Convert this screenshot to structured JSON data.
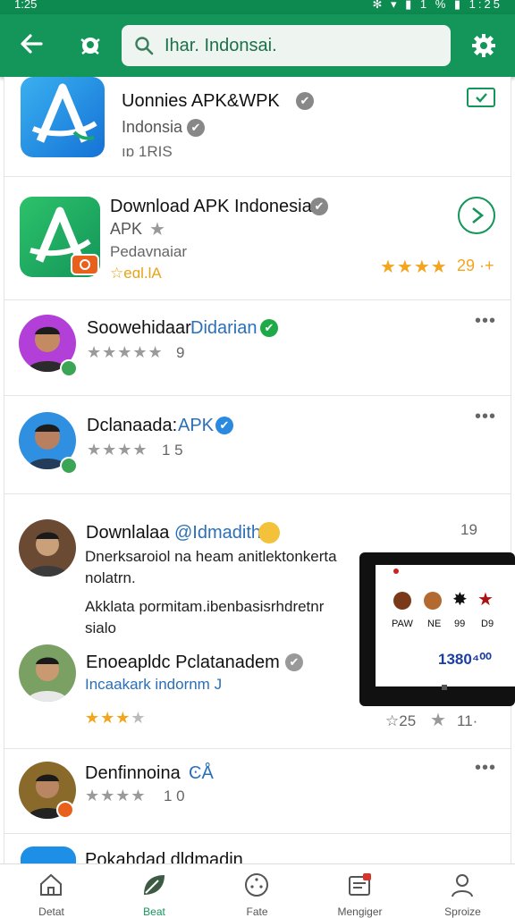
{
  "status_bar": {
    "time": "1:25",
    "right": "✻ ▾ ▮ 1 % ▮ 1:25"
  },
  "header": {
    "back_icon": "arrow-left-icon",
    "logo_icon": "bug-logo-icon",
    "search_value": "Ihar. Indonsai.",
    "settings_icon": "gear-icon"
  },
  "colors": {
    "brand": "#14955a",
    "status": "#0d8a4f",
    "star": "#f2a51d",
    "link": "#2a6fb8"
  },
  "items": [
    {
      "title": "Uonnies APK&WPK",
      "subtitle": "Indonsia",
      "meta": "ıɒ 1RIS"
    },
    {
      "title": "Download APK Indonesia",
      "subtitle": "APK",
      "meta": "Pedavnaiar",
      "meta2": "☆eɑl.lA",
      "rating": "29 ·+"
    },
    {
      "title": "Soowehidaar",
      "title_blue": "Didarian",
      "rating": "9"
    },
    {
      "title": "Dclanaada:",
      "title_blue": "APK",
      "rating": "1 5"
    },
    {
      "title": "Downlalaa",
      "title_blue": "@Idmadith",
      "time": "19",
      "line1": "Dnerksaroiol na heam anitlektonkerta",
      "line2": "nolatrn.",
      "line3": "Akklata pormitam.ibenbasisrhdretnr",
      "line4": "sialo"
    },
    {
      "title": "Enoeapldc Pclatanadem",
      "subtitle": "Incaakark indornm J",
      "count1": "25",
      "count2": "11·"
    },
    {
      "title": "Denfinnoina",
      "rating": "1 0"
    },
    {
      "title": "Pokahdad dldmadin"
    }
  ],
  "popup": {
    "labels": [
      "PAW",
      "NE",
      "99",
      "D9"
    ],
    "number": "1380⁴⁰⁰"
  },
  "nav": [
    {
      "label": "Detat",
      "icon": "home-icon"
    },
    {
      "label": "Beat",
      "icon": "leaf-icon"
    },
    {
      "label": "Fate",
      "icon": "compass-icon"
    },
    {
      "label": "Mengiger",
      "icon": "inbox-icon"
    },
    {
      "label": "Sproize",
      "icon": "person-icon"
    }
  ]
}
